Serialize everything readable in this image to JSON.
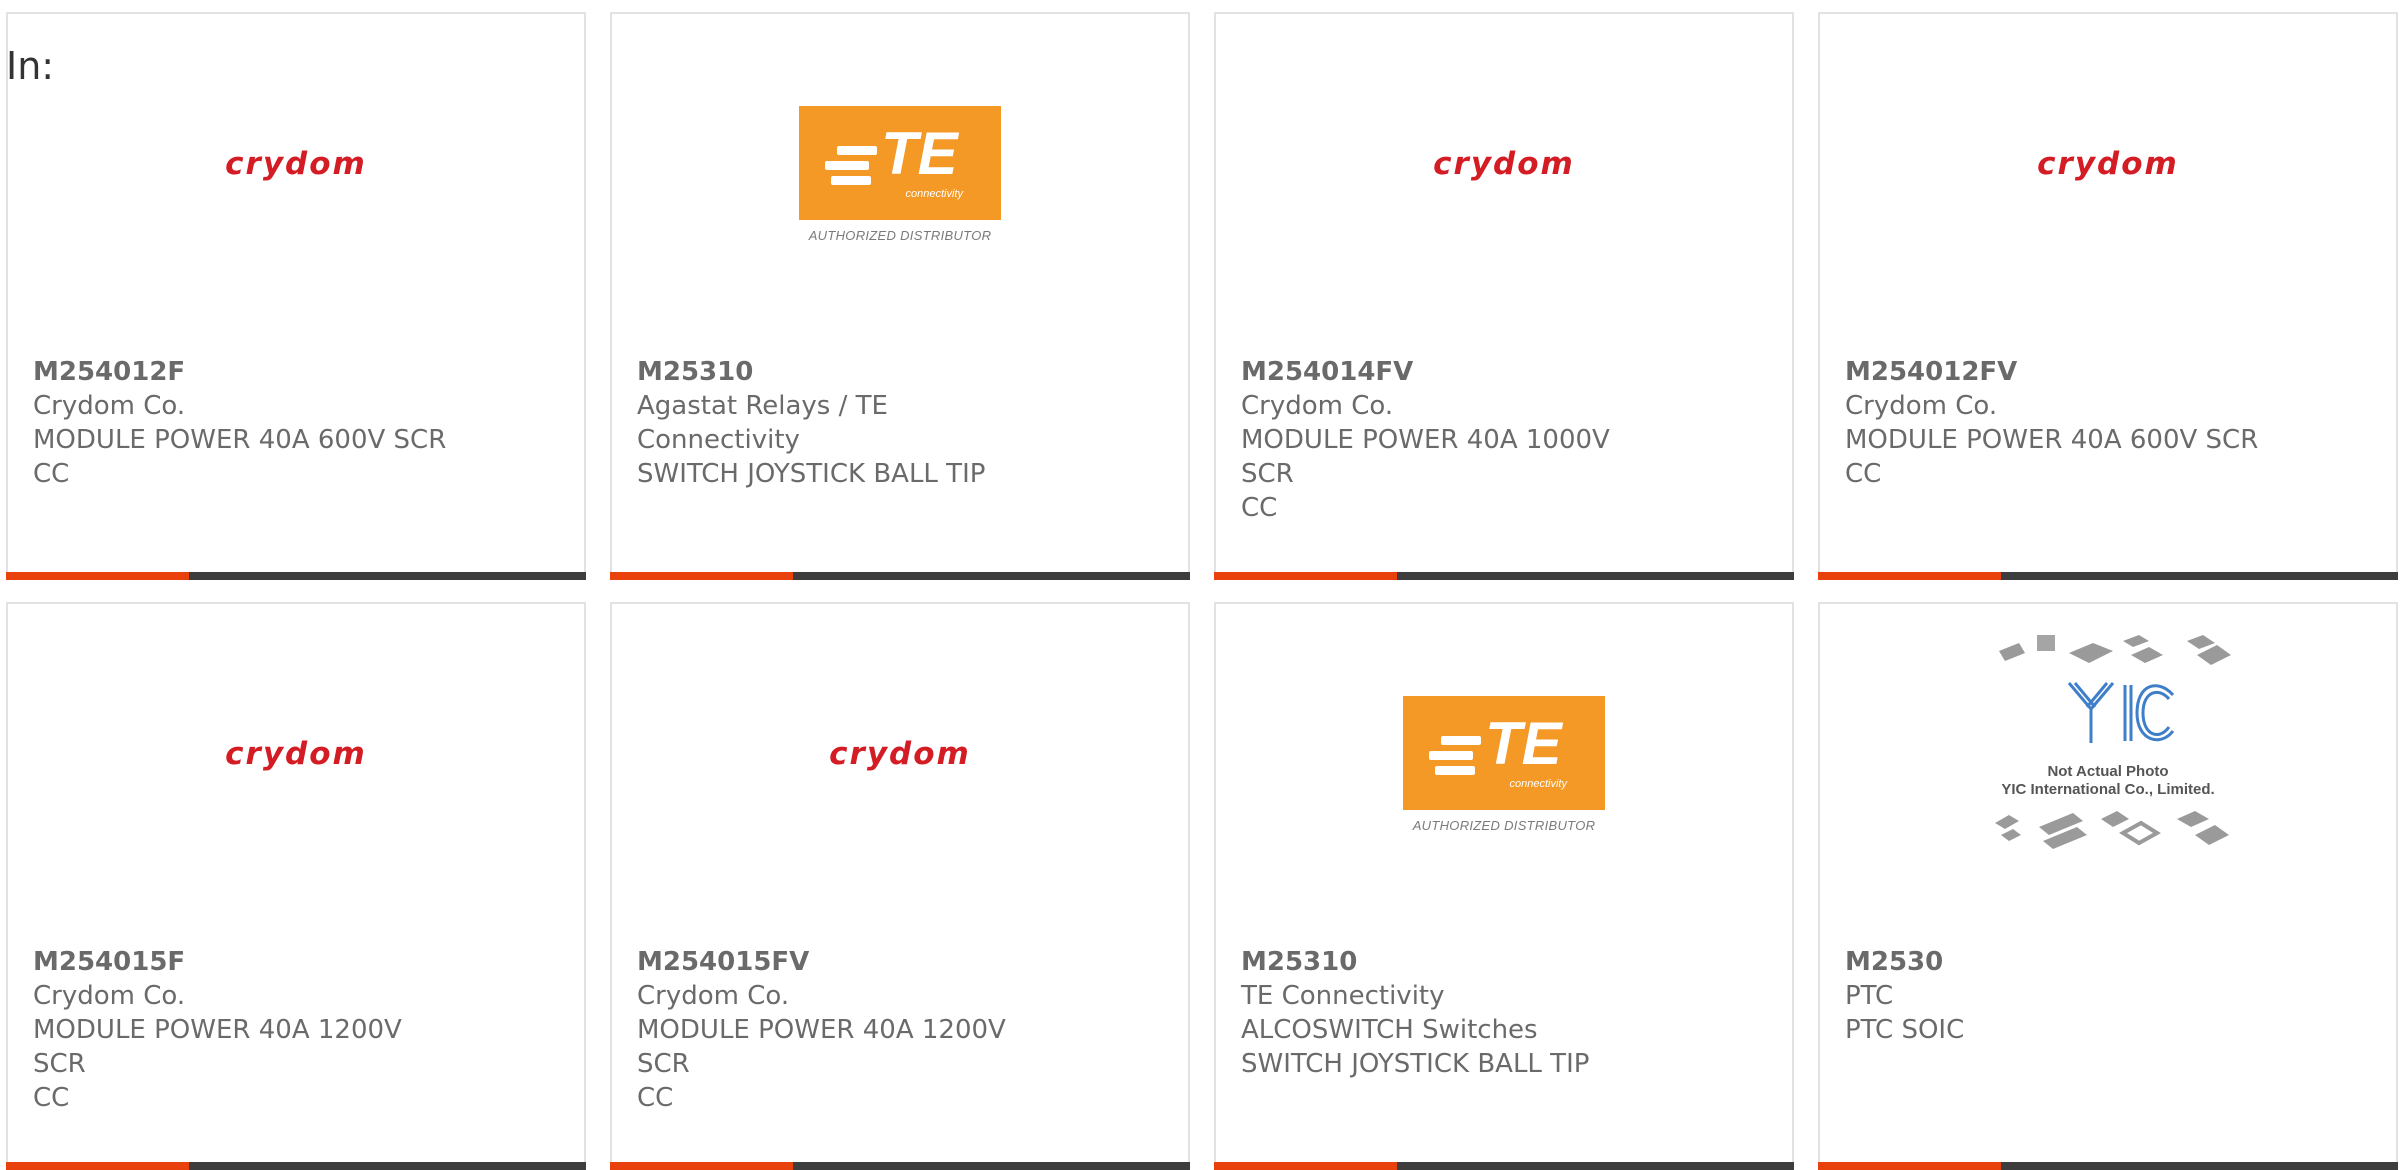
{
  "filter_label": "In:",
  "colors": {
    "accent": "#e8410b",
    "bar": "#3d3d3d",
    "crydom_red": "#d41c24",
    "te_orange": "#f49826"
  },
  "products": [
    {
      "part_number": "M254012F",
      "manufacturer": "Crydom Co.",
      "description": "MODULE POWER 40A 600V SCR",
      "extra": "CC",
      "logo": "crydom"
    },
    {
      "part_number": "M25310",
      "manufacturer": "Agastat Relays / TE Connectivity",
      "description": "SWITCH JOYSTICK BALL TIP",
      "extra": "",
      "logo": "te"
    },
    {
      "part_number": "M254014FV",
      "manufacturer": "Crydom Co.",
      "description": "MODULE POWER 40A 1000V SCR",
      "extra": "CC",
      "logo": "crydom"
    },
    {
      "part_number": "M254012FV",
      "manufacturer": "Crydom Co.",
      "description": "MODULE POWER 40A 600V SCR",
      "extra": "CC",
      "logo": "crydom"
    },
    {
      "part_number": "M254015F",
      "manufacturer": "Crydom Co.",
      "description": "MODULE POWER 40A 1200V SCR",
      "extra": "CC",
      "logo": "crydom"
    },
    {
      "part_number": "M254015FV",
      "manufacturer": "Crydom Co.",
      "description": "MODULE POWER 40A 1200V SCR",
      "extra": "CC",
      "logo": "crydom"
    },
    {
      "part_number": "M25310",
      "manufacturer": "TE Connectivity ALCOSWITCH Switches",
      "description": "SWITCH JOYSTICK BALL TIP",
      "extra": "",
      "logo": "te"
    },
    {
      "part_number": "M2530",
      "manufacturer": "PTC",
      "description": "PTC SOIC",
      "extra": "",
      "logo": "yic"
    }
  ],
  "logos": {
    "crydom": {
      "text": "crydom"
    },
    "te": {
      "text": "TE",
      "sub": "connectivity",
      "caption": "AUTHORIZED DISTRIBUTOR"
    },
    "yic": {
      "caption_line1": "Not Actual Photo",
      "caption_line2": "YIC International Co., Limited."
    }
  }
}
